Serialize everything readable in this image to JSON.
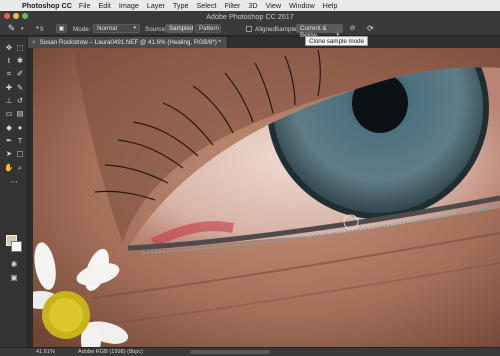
{
  "menubar": {
    "apple_glyph": "",
    "app_name": "Photoshop CC",
    "items": [
      "File",
      "Edit",
      "Image",
      "Layer",
      "Type",
      "Select",
      "Filter",
      "3D",
      "View",
      "Window",
      "Help"
    ]
  },
  "window": {
    "title": "Adobe Photoshop CC 2017"
  },
  "options": {
    "brush_size": "9",
    "mode_label": "Mode:",
    "mode_value": "Normal",
    "source_label": "Source:",
    "source_sampled": "Sampled",
    "source_pattern": "Pattern",
    "aligned_label": "Aligned",
    "sample_label": "Sample:",
    "sample_value": "Current & Below"
  },
  "tooltip": {
    "text": "Clone sample mode"
  },
  "document": {
    "tab_title": "Susan Rockstrow – Laura0491.NEF @ 41.6% (Healing, RGB/8*) *",
    "close_glyph": "×"
  },
  "status": {
    "zoom": "41.61%",
    "profile": "Adobe RGB (1998) (8bpc)"
  },
  "colors": {
    "foreground": "#d9c8b0",
    "background": "#ffffff",
    "ui_dark": "#2b2b2b",
    "menubar": "#e9e9e9"
  },
  "icons": [
    "healing-brush-icon",
    "move-icon",
    "marquee-icon",
    "lasso-icon",
    "quick-select-icon",
    "crop-icon",
    "eyedropper-icon",
    "spot-heal-icon",
    "brush-icon",
    "clone-stamp-icon",
    "history-brush-icon",
    "eraser-icon",
    "gradient-icon",
    "blur-icon",
    "dodge-icon",
    "pen-icon",
    "type-icon",
    "path-select-icon",
    "shape-icon",
    "hand-icon",
    "zoom-icon",
    "quick-mask-icon",
    "screen-mode-icon"
  ]
}
